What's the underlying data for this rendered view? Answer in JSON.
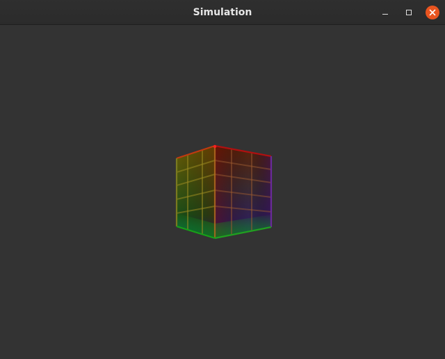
{
  "window": {
    "title": "Simulation"
  },
  "controls": {
    "minimize_icon": "minimize-icon",
    "maximize_icon": "maximize-icon",
    "close_icon": "close-icon",
    "close_color": "#e9541f"
  },
  "scene": {
    "background_color": "#333333",
    "object": "textured-cube",
    "vertex_colors": [
      "#ff0000",
      "#ffff00",
      "#00ff00",
      "#0000ff",
      "#800080"
    ]
  }
}
